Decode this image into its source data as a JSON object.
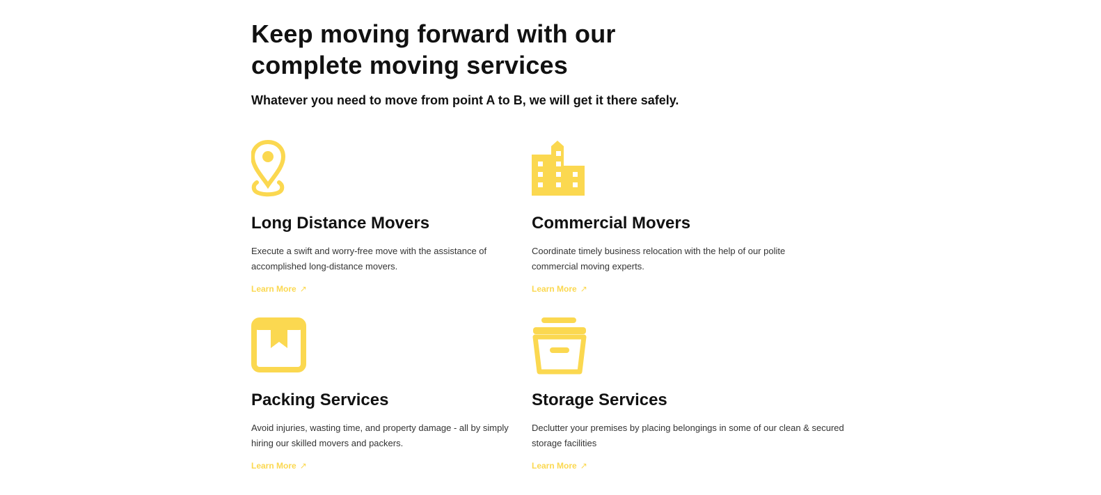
{
  "section": {
    "heading": "Keep moving forward with our complete moving services",
    "subheading": "Whatever you need to move from point A to B, we will get it there safely.",
    "accent_color": "#fbd850"
  },
  "services": [
    {
      "icon": "map-pin-icon",
      "title": "Long Distance Movers",
      "description": "Execute a swift and worry-free move with the assistance of accomplished long-distance movers.",
      "link_label": "Learn More",
      "link_icon": "arrow-up-right-icon"
    },
    {
      "icon": "building-icon",
      "title": "Commercial Movers",
      "description": "Coordinate timely business relocation with the help of our polite commercial moving experts.",
      "link_label": "Learn More",
      "link_icon": "arrow-up-right-icon"
    },
    {
      "icon": "box-icon",
      "title": "Packing Services",
      "description": "Avoid injuries, wasting time, and property damage - all by simply hiring our skilled movers and packers.",
      "link_label": "Learn More",
      "link_icon": "arrow-up-right-icon"
    },
    {
      "icon": "archive-icon",
      "title": "Storage Services",
      "description": "Declutter your premises by placing belongings in some of our clean & secured storage facilities",
      "link_label": "Learn More",
      "link_icon": "arrow-up-right-icon"
    }
  ]
}
